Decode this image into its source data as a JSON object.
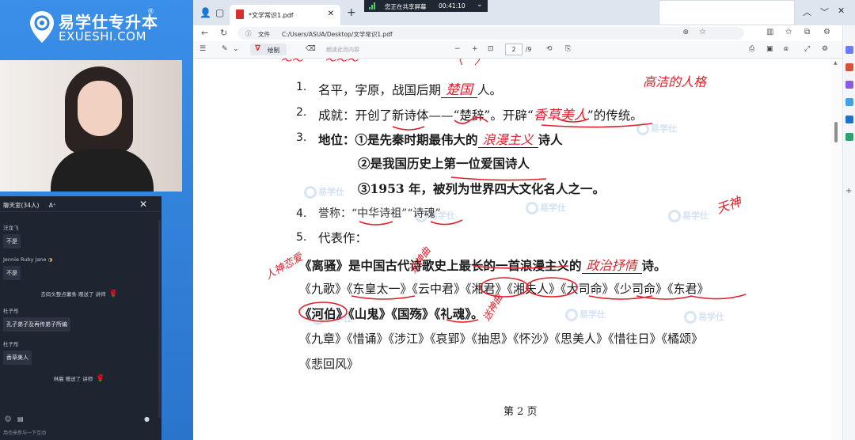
{
  "brand": {
    "name_cn": "易学仕专升本",
    "name_en": "EXUESHI.COM",
    "reg": "®"
  },
  "chat": {
    "title": "聊天室(34人)",
    "font_btn": "A⁺",
    "close": "✕",
    "messages": [
      {
        "name": "汪龙飞",
        "text": "不是"
      },
      {
        "name": "Jennie Ruby Jane",
        "text": "不是"
      },
      {
        "gift": "去码头整点薯条 赠送了 讲师"
      },
      {
        "name": "杜子彤",
        "text": "孔子弟子及再传弟子所编"
      },
      {
        "name": "杜子彤",
        "text": "香草美人"
      },
      {
        "gift": "林晨 赠送了 讲师"
      }
    ],
    "input_placeholder": "用也来参与一下互动"
  },
  "share_bar": {
    "text": "您正在共享屏幕",
    "time": "00:41:10"
  },
  "browser": {
    "tab_title": "*文学常识1.pdf",
    "address_label": "文件",
    "address_url": "C:/Users/ASUA/Desktop/文学常识1.pdf"
  },
  "pdf_toolbar": {
    "draw_label": "绘制",
    "read_aloud_label": "朗读此页内容",
    "current_page": "2",
    "total_pages": "/9"
  },
  "document": {
    "item1_label": "名平，字原，战国后期",
    "item1_blank": "楚国",
    "item1_end": "人。",
    "item2_label": "成就：开创了新诗体——“楚辞”。开辟“",
    "item2_blank": "香草美人",
    "item2_end": "”的传统。",
    "item3_label": "地位：①是先秦时期最伟大的",
    "item3_blank": "浪漫主义",
    "item3_end": "诗人",
    "item3_b": "②是我国历史上第一位爱国诗人",
    "item3_c": "③1953 年，被列为世界四大文化名人之一。",
    "item4": "誉称：“中华诗祖”“诗魂”",
    "item5": "代表作：",
    "lisao_a": "《离骚》是中国古代诗歌史上最长的一首浪漫主义的",
    "lisao_blank": "政治抒情",
    "lisao_end": "诗。",
    "jiuge": "《九歌》《东皇太一》《云中君》《湘君》《湘夫人》《大司命》《少司命》《东君》",
    "jiuge2": "《河伯》《山鬼》《国殇》《礼魂》。",
    "jiuzhang": "《九章》《惜诵》《涉江》《哀郢》《抽思》《怀沙》《思美人》《惜往日》《橘颂》",
    "jiuzhang2": "《悲回风》",
    "page_label": "第 2 页"
  },
  "handwriting": {
    "note1": "高洁的人格",
    "note2": "天神",
    "note3": "人神恋爱",
    "note4": "迎神曲",
    "note5": "送神曲"
  },
  "watermark": "易学仕"
}
